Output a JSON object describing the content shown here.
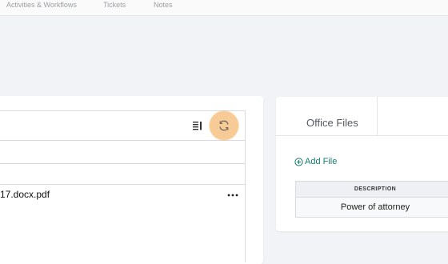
{
  "topnav": {
    "tabs": [
      "Activities & Workflows",
      "Tickets",
      "Notes"
    ]
  },
  "documents": {
    "toolbar_icon": "list-icon",
    "refresh_icon": "refresh-icon",
    "more_icon": "more-horizontal-icon",
    "rows": [
      {
        "file_name": "17.docx.pdf"
      }
    ]
  },
  "office_files": {
    "tab_label": "Office Files",
    "add_file_label": "Add File",
    "add_icon": "plus-circle-icon",
    "table": {
      "header": "DESCRIPTION",
      "rows": [
        "Power of attorney"
      ]
    }
  },
  "colors": {
    "accent": "#137e6e",
    "highlight": "#f7c990",
    "background": "#f1f3f6"
  }
}
